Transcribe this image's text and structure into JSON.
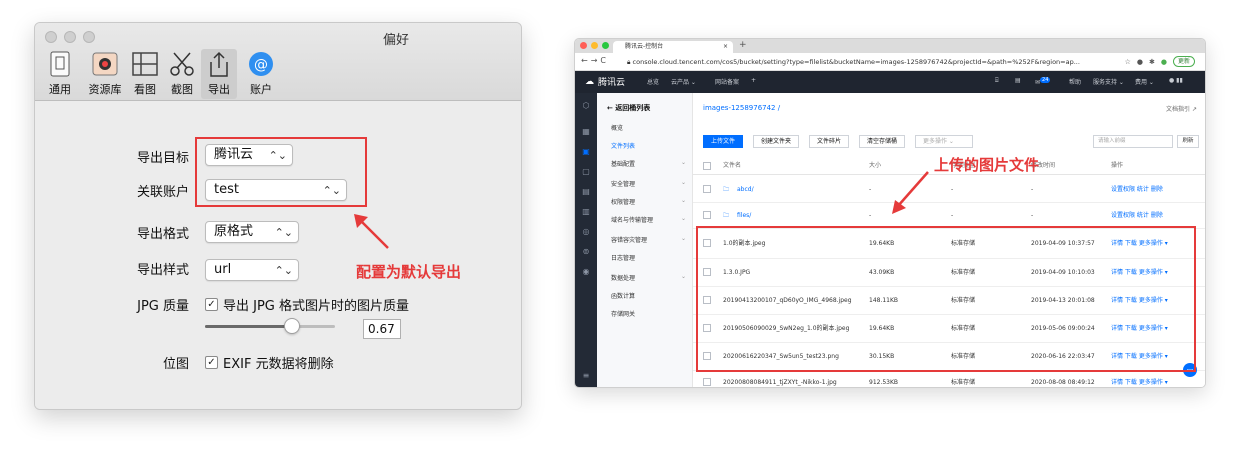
{
  "prefs": {
    "title": "偏好",
    "toolbar": [
      {
        "label": "通用",
        "icon": "general-icon"
      },
      {
        "label": "资源库",
        "icon": "library-icon"
      },
      {
        "label": "看图",
        "icon": "view-icon"
      },
      {
        "label": "截图",
        "icon": "scissors-icon"
      },
      {
        "label": "导出",
        "icon": "export-icon"
      },
      {
        "label": "账户",
        "icon": "account-icon"
      }
    ],
    "selected_tab": "导出",
    "export_target_label": "导出目标",
    "export_target_value": "腾讯云",
    "account_label": "关联账户",
    "account_value": "test",
    "format_label": "导出格式",
    "format_value": "原格式",
    "style_label": "导出样式",
    "style_value": "url",
    "jpg_label": "JPG 质量",
    "jpg_check_text": "导出 JPG 格式图片时的图片质量",
    "jpg_quality_value": "0.67",
    "jpg_quality_fraction": 0.67,
    "bitmap_label": "位图",
    "exif_check_text": "EXIF 元数据将删除",
    "check_mark": "✓",
    "annotation": "配置为默认导出",
    "accent_red": "#e53a3a"
  },
  "browser": {
    "tab_title": "腾讯云-控制台",
    "tab_close": "×",
    "new_tab": "+",
    "url": "console.cloud.tencent.com/cos5/bucket/setting?type=filelist&bucketName=images-1258976742&projectId=&path=%252F&region=ap...",
    "update_button": "更新",
    "header": {
      "logo": "腾讯云",
      "menu": [
        "总览",
        "云产品 ⌄",
        "网站备案",
        "+"
      ],
      "right": [
        "帮助",
        "服务支持 ⌄",
        "费用 ⌄"
      ],
      "badge": "24"
    },
    "sidebar": {
      "back": "← 返回桶列表",
      "items": [
        "概览",
        "文件列表",
        "基础配置",
        "安全管理",
        "权限管理",
        "域名与传输管理",
        "容错容灾管理",
        "日志管理",
        "数据处理",
        "函数计算",
        "存储网关"
      ],
      "active": "文件列表"
    },
    "breadcrumb": "images-1258976742  /",
    "doc_link": "文档指引",
    "buttons": [
      "上传文件",
      "创建文件夹",
      "文件碎片",
      "清空存储桶",
      "更多操作 ⌄"
    ],
    "search_placeholder": "请输入前缀",
    "refresh": "刷新",
    "columns": [
      "文件名",
      "大小",
      "存储类型",
      "修改时间",
      "操作"
    ],
    "folders": [
      {
        "name": "abcd/",
        "size": "-",
        "type": "-",
        "time": "-",
        "ops": "设置权限  统计  删除"
      },
      {
        "name": "files/",
        "size": "-",
        "type": "-",
        "time": "-",
        "ops": "设置权限  统计  删除"
      }
    ],
    "files": [
      {
        "name": "1.0的副本.jpeg",
        "size": "19.64KB",
        "type": "标准存储",
        "time": "2019-04-09 10:37:57",
        "ops": "详情  下载  更多操作 ▾"
      },
      {
        "name": "1.3.0.JPG",
        "size": "43.09KB",
        "type": "标准存储",
        "time": "2019-04-09 10:10:03",
        "ops": "详情  下载  更多操作 ▾"
      },
      {
        "name": "20190413200107_qD60yO_IMG_4968.jpeg",
        "size": "148.11KB",
        "type": "标准存储",
        "time": "2019-04-13 20:01:08",
        "ops": "详情  下载  更多操作 ▾"
      },
      {
        "name": "20190506090029_SwN2eg_1.0的副本.jpeg",
        "size": "19.64KB",
        "type": "标准存储",
        "time": "2019-05-06 09:00:24",
        "ops": "详情  下载  更多操作 ▾"
      },
      {
        "name": "20200616220347_Sw5un5_test23.png",
        "size": "30.15KB",
        "type": "标准存储",
        "time": "2020-06-16 22:03:47",
        "ops": "详情  下载  更多操作 ▾"
      },
      {
        "name": "20200808084911_tjZXYt_-Nikko-1.jpg",
        "size": "912.53KB",
        "type": "标准存储",
        "time": "2020-08-08 08:49:12",
        "ops": "详情  下载  更多操作 ▾"
      }
    ],
    "annotation": "上传的图片文件",
    "chat_icon": "chat-icon",
    "brand_blue": "#006eff"
  }
}
